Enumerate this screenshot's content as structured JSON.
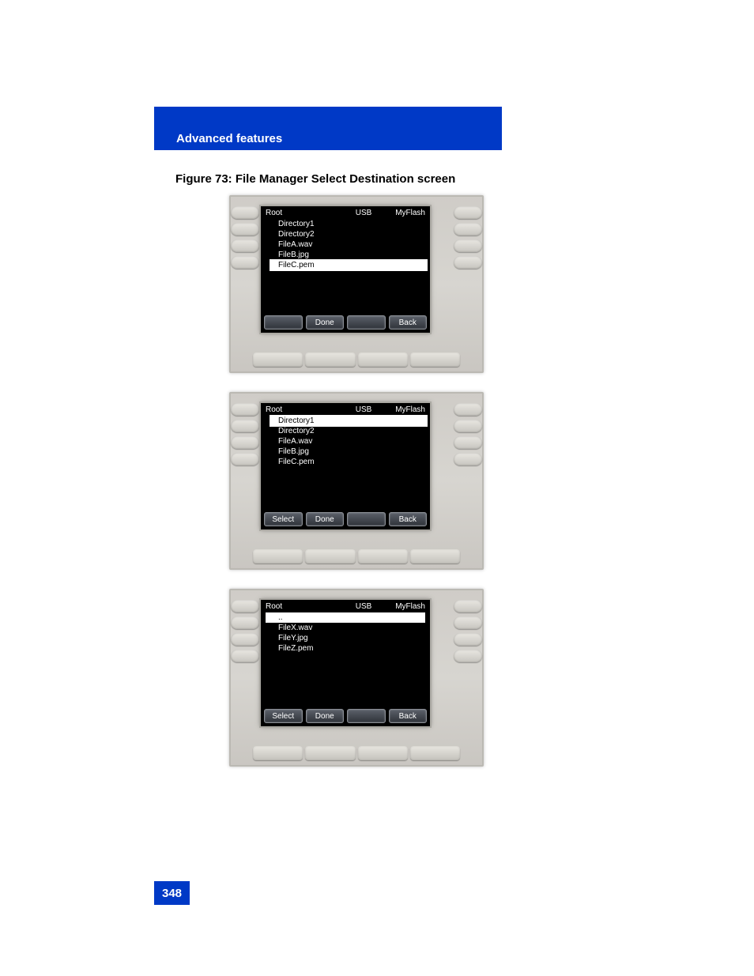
{
  "header": {
    "section_title": "Advanced features"
  },
  "figure": {
    "caption": "Figure 73: File Manager Select Destination screen"
  },
  "page_number": "348",
  "screens": [
    {
      "tabs": {
        "root": "Root",
        "usb": "USB",
        "myflash": "MyFlash"
      },
      "items": [
        {
          "label": "Directory1",
          "selected": false
        },
        {
          "label": "Directory2",
          "selected": false
        },
        {
          "label": "FileA.wav",
          "selected": false
        },
        {
          "label": "FileB.jpg",
          "selected": false
        },
        {
          "label": "FileC.pem",
          "selected": true
        }
      ],
      "softkeys": [
        "",
        "Done",
        "",
        "Back"
      ]
    },
    {
      "tabs": {
        "root": "Root",
        "usb": "USB",
        "myflash": "MyFlash"
      },
      "items": [
        {
          "label": "Directory1",
          "selected": true
        },
        {
          "label": "Directory2",
          "selected": false
        },
        {
          "label": "FileA.wav",
          "selected": false
        },
        {
          "label": "FileB.jpg",
          "selected": false
        },
        {
          "label": "FileC.pem",
          "selected": false
        }
      ],
      "softkeys": [
        "Select",
        "Done",
        "",
        "Back"
      ]
    },
    {
      "tabs": {
        "root": "Root",
        "usb": "USB",
        "myflash": "MyFlash"
      },
      "items": [
        {
          "label": "..",
          "selected": true
        },
        {
          "label": "FileX.wav",
          "selected": false
        },
        {
          "label": "FileY.jpg",
          "selected": false
        },
        {
          "label": "FileZ.pem",
          "selected": false
        }
      ],
      "softkeys": [
        "Select",
        "Done",
        "",
        "Back"
      ]
    }
  ]
}
